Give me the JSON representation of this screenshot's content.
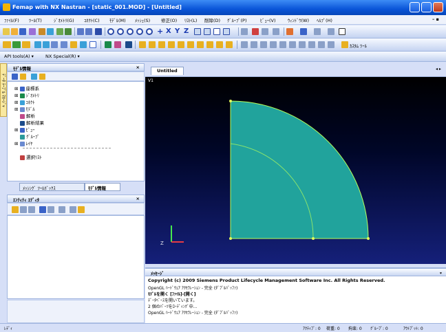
{
  "window": {
    "title": "Femap with NX Nastran - [static_001.MOD] - [Untitled]"
  },
  "menu": [
    "ﾌｧｲﾙ(F)",
    "ﾂｰﾙ(T)",
    "ｼﾞｵﾒﾄﾘ(G)",
    "ｺﾈｸﾄ(C)",
    "ﾓﾃﾞﾙ(M)",
    "ﾒｯｼｭ(S)",
    "修正(O)",
    "ﾘｽﾄ(L)",
    "削除(D)",
    "ｸﾞﾙｰﾌﾟ(P)",
    "ﾋﾞｭｰ(V)",
    "ｳｨﾝﾄﾞｳ(W)",
    "ﾍﾙﾌﾟ(H)"
  ],
  "toolbar": {
    "api_tools": "API tools(A) ▾",
    "nx_special": "NX Special(R) ▾",
    "custom_tools": "ｶｽﾀﾑ ﾂｰﾙ"
  },
  "model_info": {
    "title": "ﾓﾃﾞﾙ情報",
    "close": "× ",
    "tree": [
      "座標系",
      "ｼﾞｵﾒﾄﾘ",
      "ｺﾈｸﾄ",
      "ﾓﾃﾞﾙ",
      "解析",
      "解析結果",
      "ﾋﾞｭｰ",
      "ｸﾞﾙｰﾌﾟ",
      "ﾚｲﾔ",
      "選択ﾘｽﾄ"
    ]
  },
  "panel_tabs": {
    "meshing": "ﾒｯｼﾝｸﾞ ﾂｰﾙﾎﾞｯｸｽ",
    "model_info": "ﾓﾃﾞﾙ情報"
  },
  "entity_editor": {
    "title": "ｴﾝﾃｨﾃｨ ｴﾃﾞｨﾀ",
    "close": "× "
  },
  "side_tab": "ﾃﾞｰﾀ ﾃｰﾌﾞﾙ ﾏﾈｰｼﾞｬ",
  "graphics": {
    "tab": "Untitled",
    "view_label": "V1",
    "nav": "◂ ▸"
  },
  "messages": {
    "title": "ﾒｯｾｰｼﾞ",
    "pin": "ᵩ",
    "lines": [
      "Copyright (c) 2009 Siemens Product Lifecycle Management Software Inc. All Rights Reserved.",
      "OpenGL ﾊｰﾄﾞｳｪｱ ｱｸｾﾗﾚｰｼｮﾝ - 完全 (ﾀﾞﾌﾞﾙﾊﾞｯﾌｧ)",
      "ﾓﾃﾞﾙを開く [ﾌｧｲﾙ]-[開く]",
      "ﾃﾞｰﾀﾍﾞｰｽを開いています。",
      "2 個のﾊﾟｰﾂをﾛｰﾃﾞｨﾝｸﾞ中...",
      "OpenGL ﾊｰﾄﾞｳｪｱ ｱｸｾﾗﾚｰｼｮﾝ - 完全 (ﾀﾞﾌﾞﾙﾊﾞｯﾌｧ)"
    ]
  },
  "status": {
    "left": "ﾚﾃﾞｨ",
    "items": [
      "ｱｸﾃｨﾌﾞ: 0",
      "荷重: 0",
      "拘束: 0",
      "ｸﾞﾙｰﾌﾟ: 0",
      "ｱｳﾄﾌﾟｯﾄ: 0"
    ]
  },
  "colors": {
    "title_blue": "#0a55d8",
    "model_fill": "#21a39c",
    "model_edge": "#b7ff5a",
    "gfx_bg": "#000628"
  }
}
